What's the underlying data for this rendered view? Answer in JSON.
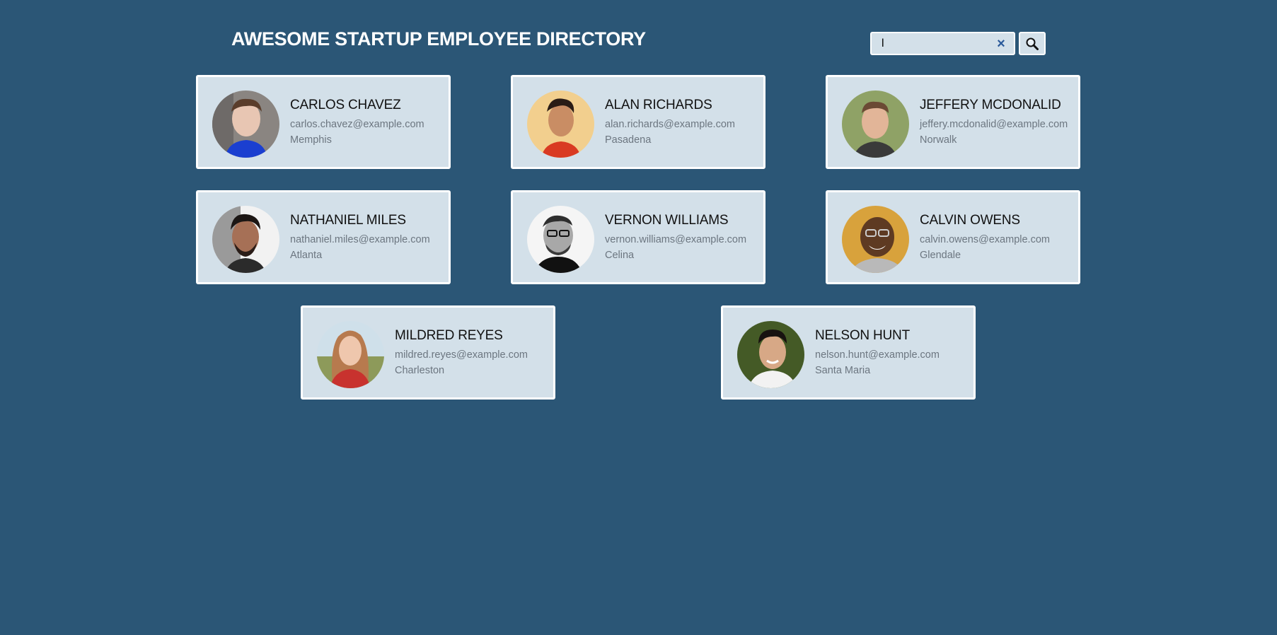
{
  "header": {
    "title": "AWESOME STARTUP EMPLOYEE DIRECTORY"
  },
  "search": {
    "value": "l",
    "placeholder": "",
    "clear_label": "×"
  },
  "colors": {
    "background": "#2b5676",
    "card": "#d3e0e9",
    "card_border": "#ffffff",
    "clear_icon": "#2b5a9a"
  },
  "employees": [
    {
      "name": "CARLOS CHAVEZ",
      "email": "carlos.chavez@example.com",
      "city": "Memphis"
    },
    {
      "name": "ALAN RICHARDS",
      "email": "alan.richards@example.com",
      "city": "Pasadena"
    },
    {
      "name": "JEFFERY MCDONALID",
      "email": "jeffery.mcdonalid@example.com",
      "city": "Norwalk"
    },
    {
      "name": "NATHANIEL MILES",
      "email": "nathaniel.miles@example.com",
      "city": "Atlanta"
    },
    {
      "name": "VERNON WILLIAMS",
      "email": "vernon.williams@example.com",
      "city": "Celina"
    },
    {
      "name": "CALVIN OWENS",
      "email": "calvin.owens@example.com",
      "city": "Glendale"
    },
    {
      "name": "MILDRED REYES",
      "email": "mildred.reyes@example.com",
      "city": "Charleston"
    },
    {
      "name": "NELSON HUNT",
      "email": "nelson.hunt@example.com",
      "city": "Santa Maria"
    }
  ]
}
